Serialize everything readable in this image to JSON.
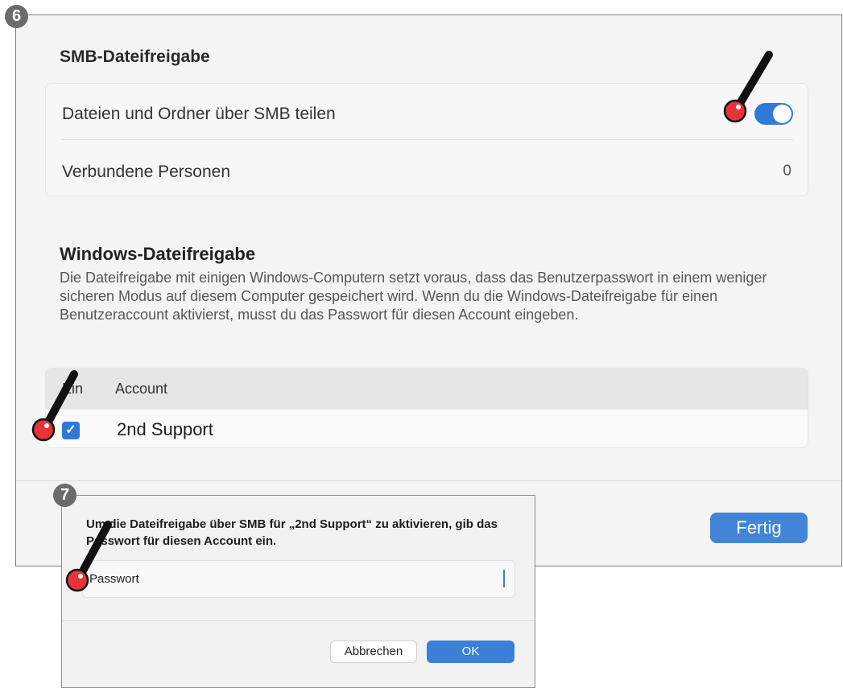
{
  "steps": {
    "six": "6",
    "seven": "7"
  },
  "smb": {
    "title": "SMB-Dateifreigabe",
    "share_label": "Dateien und Ordner über SMB teilen",
    "share_enabled": true,
    "connected_label": "Verbundene Personen",
    "connected_count": "0"
  },
  "windows": {
    "title": "Windows-Dateifreigabe",
    "description": "Die Dateifreigabe mit einigen Windows-Computern setzt voraus, dass das Benutzerpasswort in einem weniger sicheren Modus auf diesem Computer gespeichert wird. Wenn du die Windows-Dateifreigabe für einen Benutzeraccount aktivierst, musst du das Passwort für diesen Account eingeben.",
    "table": {
      "col_on": "Ein",
      "col_account": "Account",
      "rows": [
        {
          "checked": true,
          "account": "2nd Support"
        }
      ]
    }
  },
  "footer": {
    "done_label": "Fertig"
  },
  "dialog": {
    "message": "Um die Dateifreigabe über SMB für „2nd Support“ zu aktivieren, gib das Passwort für diesen Account ein.",
    "password_label": "Passwort",
    "cancel_label": "Abbrechen",
    "ok_label": "OK"
  },
  "colors": {
    "accent": "#2f7ad8",
    "marker_red": "#e8333a",
    "step_badge": "#6b6b6b"
  },
  "icons": {
    "toggle": "toggle-switch",
    "check": "checkbox-checked",
    "marker": "pen-marker-icon"
  }
}
